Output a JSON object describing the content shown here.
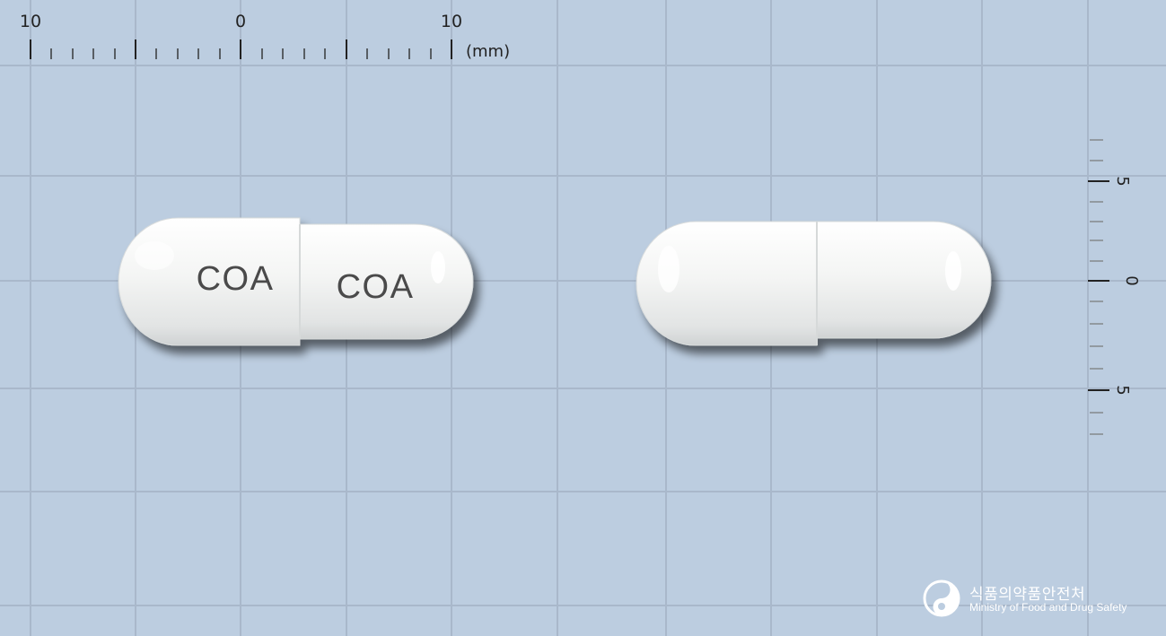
{
  "ruler_top": {
    "labels": [
      "10",
      "0",
      "10"
    ],
    "unit": "(mm)"
  },
  "ruler_right": {
    "labels": [
      "5",
      "0",
      "5"
    ]
  },
  "capsules": [
    {
      "name": "capsule-front",
      "imprint_left": "COA",
      "imprint_right": "COA"
    },
    {
      "name": "capsule-back",
      "imprint_left": "",
      "imprint_right": ""
    }
  ],
  "watermark": {
    "korean": "식품의약품안전처",
    "english": "Ministry of Food and Drug Safety",
    "icon": "mfds-logo-icon"
  },
  "colors": {
    "background": "#bccde0",
    "gridline": "#a9b8cb",
    "capsule_body": "#f2f3f2",
    "imprint": "#4a4a4a",
    "ruler": "#222222"
  }
}
